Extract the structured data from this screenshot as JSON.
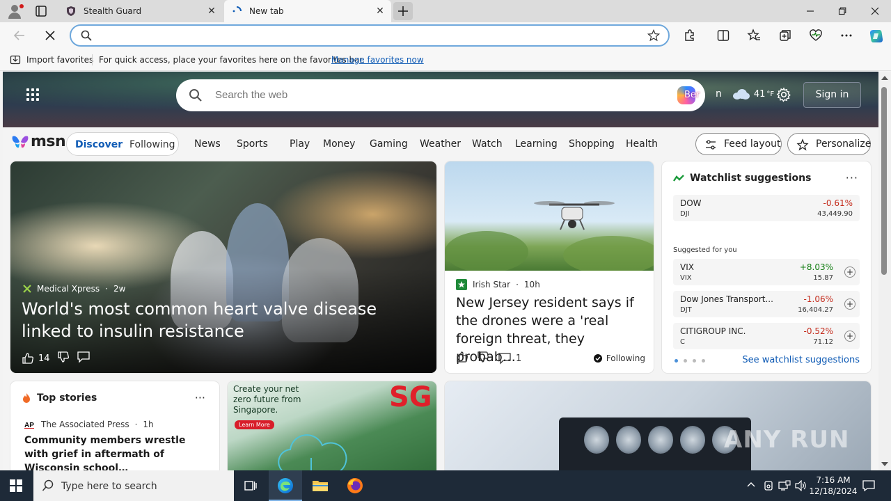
{
  "browser": {
    "tabs": [
      {
        "title": "Stealth Guard"
      },
      {
        "title": "New tab"
      }
    ],
    "address": {
      "value": "",
      "placeholder": ""
    }
  },
  "favorites_bar": {
    "import_label": "Import favorites",
    "message": "For quick access, place your favorites here on the favorites bar.",
    "manage_link": "Manage favorites now"
  },
  "msn": {
    "search_placeholder": "Search the web",
    "rewards_label": "Ber",
    "rewards_tail": "n",
    "weather": {
      "temp": "41",
      "unit": "°F"
    },
    "sign_in": "Sign in",
    "logo_text": "msn",
    "feed_toggle": {
      "discover": "Discover",
      "following": "Following"
    },
    "nav": [
      "News",
      "Sports",
      "Play",
      "Money",
      "Gaming",
      "Weather",
      "Watch",
      "Learning",
      "Shopping",
      "Health"
    ],
    "feed_layout": "Feed layout",
    "personalize": "Personalize"
  },
  "cards": {
    "hero_story": {
      "source": "Medical Xpress",
      "age": "2w",
      "headline": "World's most common heart valve disease linked to insulin resistance",
      "likes": "14"
    },
    "drone_story": {
      "source": "Irish Star",
      "age": "10h",
      "headline": "New Jersey resident says if the drones were a 'real foreign threat, they probab…",
      "comments": "1",
      "following": "Following"
    },
    "watchlist": {
      "title": "Watchlist suggestions",
      "primary": {
        "name": "DOW",
        "symbol": "DJI",
        "change": "-0.61%",
        "price": "43,449.90"
      },
      "suggested_label": "Suggested for you",
      "suggested": [
        {
          "name": "VIX",
          "symbol": "VIX",
          "change": "+8.03%",
          "price": "15.87"
        },
        {
          "name": "Dow Jones Transport...",
          "symbol": "DJT",
          "change": "-1.06%",
          "price": "16,404.27"
        },
        {
          "name": "CITIGROUP INC.",
          "symbol": "C",
          "change": "-0.52%",
          "price": "71.12"
        }
      ],
      "see_all": "See watchlist suggestions"
    },
    "top_stories": {
      "title": "Top stories",
      "source": "The Associated Press",
      "age": "1h",
      "headline": "Community members wrestle with grief in aftermath of Wisconsin school…"
    },
    "ad": {
      "text": "Create your net zero future from Singapore.",
      "button": "Learn More",
      "brand": "SG"
    }
  },
  "watermark": "ANY RUN",
  "taskbar": {
    "search_placeholder": "Type here to search",
    "time": "7:16 AM",
    "date": "12/18/2024"
  },
  "colors": {
    "accent": "#0f5bb5",
    "negative": "#c42b1c",
    "positive": "#107c10",
    "taskbar": "#1e2a38"
  }
}
